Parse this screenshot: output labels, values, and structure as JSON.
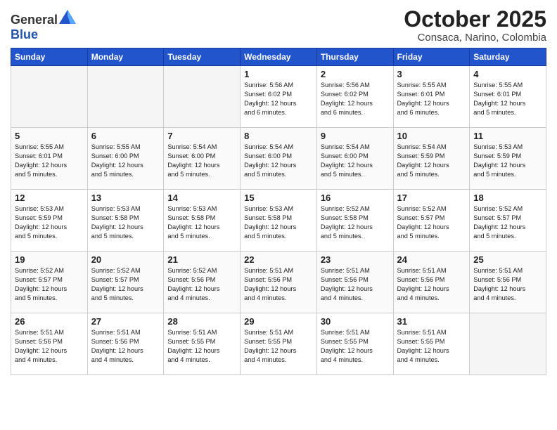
{
  "header": {
    "logo_general": "General",
    "logo_blue": "Blue",
    "month": "October 2025",
    "location": "Consaca, Narino, Colombia"
  },
  "weekdays": [
    "Sunday",
    "Monday",
    "Tuesday",
    "Wednesday",
    "Thursday",
    "Friday",
    "Saturday"
  ],
  "weeks": [
    [
      {
        "day": "",
        "info": ""
      },
      {
        "day": "",
        "info": ""
      },
      {
        "day": "",
        "info": ""
      },
      {
        "day": "1",
        "info": "Sunrise: 5:56 AM\nSunset: 6:02 PM\nDaylight: 12 hours\nand 6 minutes."
      },
      {
        "day": "2",
        "info": "Sunrise: 5:56 AM\nSunset: 6:02 PM\nDaylight: 12 hours\nand 6 minutes."
      },
      {
        "day": "3",
        "info": "Sunrise: 5:55 AM\nSunset: 6:01 PM\nDaylight: 12 hours\nand 6 minutes."
      },
      {
        "day": "4",
        "info": "Sunrise: 5:55 AM\nSunset: 6:01 PM\nDaylight: 12 hours\nand 5 minutes."
      }
    ],
    [
      {
        "day": "5",
        "info": "Sunrise: 5:55 AM\nSunset: 6:01 PM\nDaylight: 12 hours\nand 5 minutes."
      },
      {
        "day": "6",
        "info": "Sunrise: 5:55 AM\nSunset: 6:00 PM\nDaylight: 12 hours\nand 5 minutes."
      },
      {
        "day": "7",
        "info": "Sunrise: 5:54 AM\nSunset: 6:00 PM\nDaylight: 12 hours\nand 5 minutes."
      },
      {
        "day": "8",
        "info": "Sunrise: 5:54 AM\nSunset: 6:00 PM\nDaylight: 12 hours\nand 5 minutes."
      },
      {
        "day": "9",
        "info": "Sunrise: 5:54 AM\nSunset: 6:00 PM\nDaylight: 12 hours\nand 5 minutes."
      },
      {
        "day": "10",
        "info": "Sunrise: 5:54 AM\nSunset: 5:59 PM\nDaylight: 12 hours\nand 5 minutes."
      },
      {
        "day": "11",
        "info": "Sunrise: 5:53 AM\nSunset: 5:59 PM\nDaylight: 12 hours\nand 5 minutes."
      }
    ],
    [
      {
        "day": "12",
        "info": "Sunrise: 5:53 AM\nSunset: 5:59 PM\nDaylight: 12 hours\nand 5 minutes."
      },
      {
        "day": "13",
        "info": "Sunrise: 5:53 AM\nSunset: 5:58 PM\nDaylight: 12 hours\nand 5 minutes."
      },
      {
        "day": "14",
        "info": "Sunrise: 5:53 AM\nSunset: 5:58 PM\nDaylight: 12 hours\nand 5 minutes."
      },
      {
        "day": "15",
        "info": "Sunrise: 5:53 AM\nSunset: 5:58 PM\nDaylight: 12 hours\nand 5 minutes."
      },
      {
        "day": "16",
        "info": "Sunrise: 5:52 AM\nSunset: 5:58 PM\nDaylight: 12 hours\nand 5 minutes."
      },
      {
        "day": "17",
        "info": "Sunrise: 5:52 AM\nSunset: 5:57 PM\nDaylight: 12 hours\nand 5 minutes."
      },
      {
        "day": "18",
        "info": "Sunrise: 5:52 AM\nSunset: 5:57 PM\nDaylight: 12 hours\nand 5 minutes."
      }
    ],
    [
      {
        "day": "19",
        "info": "Sunrise: 5:52 AM\nSunset: 5:57 PM\nDaylight: 12 hours\nand 5 minutes."
      },
      {
        "day": "20",
        "info": "Sunrise: 5:52 AM\nSunset: 5:57 PM\nDaylight: 12 hours\nand 5 minutes."
      },
      {
        "day": "21",
        "info": "Sunrise: 5:52 AM\nSunset: 5:56 PM\nDaylight: 12 hours\nand 4 minutes."
      },
      {
        "day": "22",
        "info": "Sunrise: 5:51 AM\nSunset: 5:56 PM\nDaylight: 12 hours\nand 4 minutes."
      },
      {
        "day": "23",
        "info": "Sunrise: 5:51 AM\nSunset: 5:56 PM\nDaylight: 12 hours\nand 4 minutes."
      },
      {
        "day": "24",
        "info": "Sunrise: 5:51 AM\nSunset: 5:56 PM\nDaylight: 12 hours\nand 4 minutes."
      },
      {
        "day": "25",
        "info": "Sunrise: 5:51 AM\nSunset: 5:56 PM\nDaylight: 12 hours\nand 4 minutes."
      }
    ],
    [
      {
        "day": "26",
        "info": "Sunrise: 5:51 AM\nSunset: 5:56 PM\nDaylight: 12 hours\nand 4 minutes."
      },
      {
        "day": "27",
        "info": "Sunrise: 5:51 AM\nSunset: 5:56 PM\nDaylight: 12 hours\nand 4 minutes."
      },
      {
        "day": "28",
        "info": "Sunrise: 5:51 AM\nSunset: 5:55 PM\nDaylight: 12 hours\nand 4 minutes."
      },
      {
        "day": "29",
        "info": "Sunrise: 5:51 AM\nSunset: 5:55 PM\nDaylight: 12 hours\nand 4 minutes."
      },
      {
        "day": "30",
        "info": "Sunrise: 5:51 AM\nSunset: 5:55 PM\nDaylight: 12 hours\nand 4 minutes."
      },
      {
        "day": "31",
        "info": "Sunrise: 5:51 AM\nSunset: 5:55 PM\nDaylight: 12 hours\nand 4 minutes."
      },
      {
        "day": "",
        "info": ""
      }
    ]
  ]
}
